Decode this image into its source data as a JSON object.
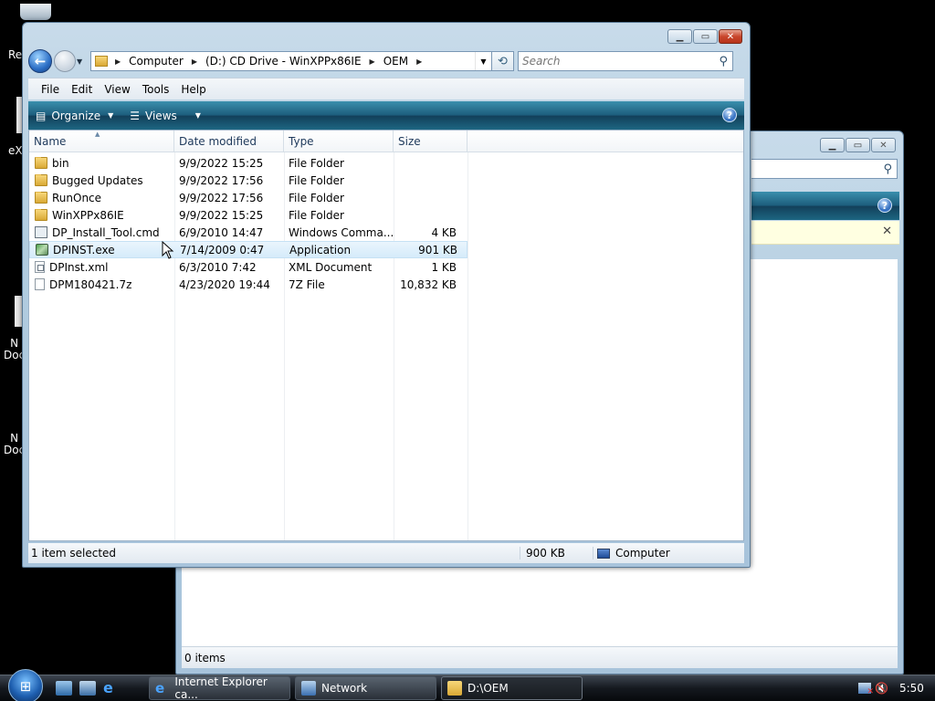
{
  "desktop": {
    "icons": [
      {
        "label": "Re"
      },
      {
        "label": "eX"
      },
      {
        "label": "N\nDoc"
      },
      {
        "label": "N\nDoc"
      }
    ]
  },
  "back_window": {
    "status": "0 items"
  },
  "front_window": {
    "breadcrumbs": [
      "Computer",
      "(D:) CD Drive - WinXPPx86IE",
      "OEM"
    ],
    "search_placeholder": "Search",
    "menu": [
      "File",
      "Edit",
      "View",
      "Tools",
      "Help"
    ],
    "commands": {
      "organize": "Organize",
      "views": "Views"
    },
    "columns": {
      "name": "Name",
      "date": "Date modified",
      "type": "Type",
      "size": "Size"
    },
    "files": [
      {
        "name": "bin",
        "date": "9/9/2022 15:25",
        "type": "File Folder",
        "size": "",
        "icon": "folder-icon"
      },
      {
        "name": "Bugged Updates",
        "date": "9/9/2022 17:56",
        "type": "File Folder",
        "size": "",
        "icon": "folder-icon"
      },
      {
        "name": "RunOnce",
        "date": "9/9/2022 17:56",
        "type": "File Folder",
        "size": "",
        "icon": "folder-icon"
      },
      {
        "name": "WinXPPx86IE",
        "date": "9/9/2022 15:25",
        "type": "File Folder",
        "size": "",
        "icon": "folder-icon"
      },
      {
        "name": "DP_Install_Tool.cmd",
        "date": "6/9/2010 14:47",
        "type": "Windows Comma...",
        "size": "4 KB",
        "icon": "cmd-file-icon"
      },
      {
        "name": "DPINST.exe",
        "date": "7/14/2009 0:47",
        "type": "Application",
        "size": "901 KB",
        "icon": "exe-file-icon"
      },
      {
        "name": "DPInst.xml",
        "date": "6/3/2010 7:42",
        "type": "XML Document",
        "size": "1 KB",
        "icon": "xml-file-icon"
      },
      {
        "name": "DPM180421.7z",
        "date": "4/23/2020 19:44",
        "type": "7Z File",
        "size": "10,832 KB",
        "icon": "file-icon"
      }
    ],
    "status": {
      "selection": "1 item selected",
      "size": "900 KB",
      "location": "Computer"
    }
  },
  "taskbar": {
    "buttons": [
      "Internet Explorer ca...",
      "Network",
      "D:\\OEM"
    ],
    "clock": "5:50"
  }
}
